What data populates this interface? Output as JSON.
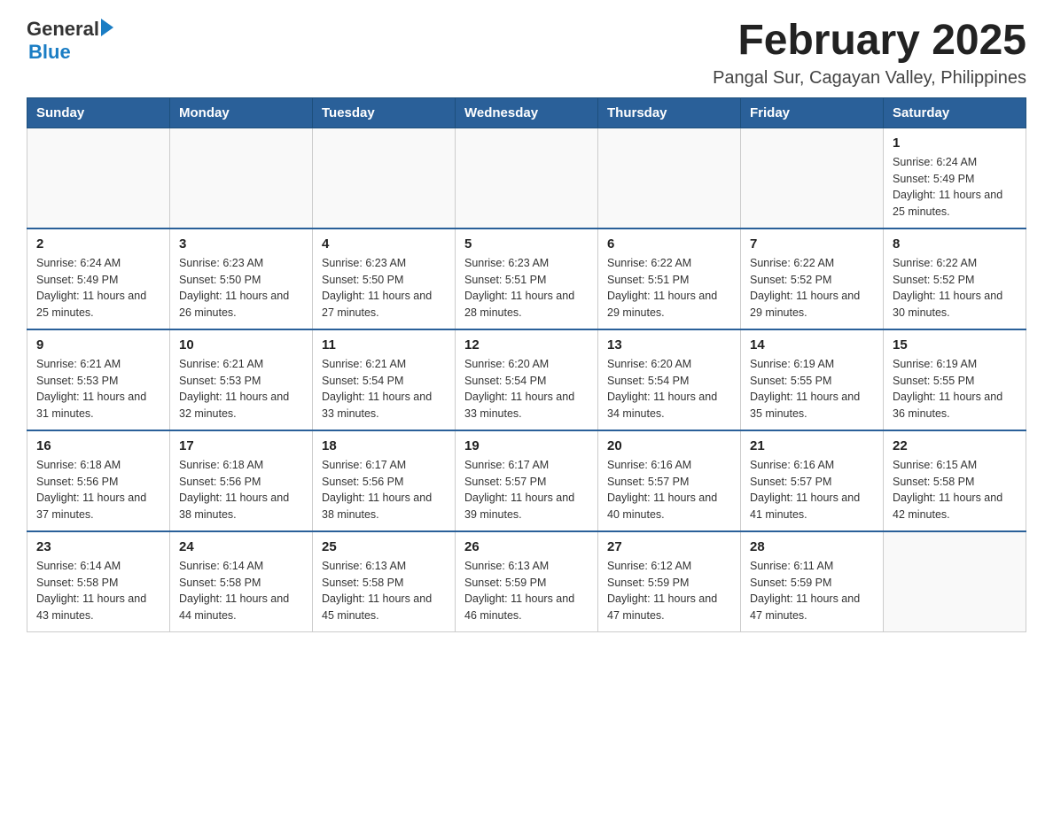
{
  "header": {
    "logo_general": "General",
    "logo_blue": "Blue",
    "month_title": "February 2025",
    "location": "Pangal Sur, Cagayan Valley, Philippines"
  },
  "weekdays": [
    "Sunday",
    "Monday",
    "Tuesday",
    "Wednesday",
    "Thursday",
    "Friday",
    "Saturday"
  ],
  "weeks": [
    [
      {
        "day": "",
        "sunrise": "",
        "sunset": "",
        "daylight": ""
      },
      {
        "day": "",
        "sunrise": "",
        "sunset": "",
        "daylight": ""
      },
      {
        "day": "",
        "sunrise": "",
        "sunset": "",
        "daylight": ""
      },
      {
        "day": "",
        "sunrise": "",
        "sunset": "",
        "daylight": ""
      },
      {
        "day": "",
        "sunrise": "",
        "sunset": "",
        "daylight": ""
      },
      {
        "day": "",
        "sunrise": "",
        "sunset": "",
        "daylight": ""
      },
      {
        "day": "1",
        "sunrise": "Sunrise: 6:24 AM",
        "sunset": "Sunset: 5:49 PM",
        "daylight": "Daylight: 11 hours and 25 minutes."
      }
    ],
    [
      {
        "day": "2",
        "sunrise": "Sunrise: 6:24 AM",
        "sunset": "Sunset: 5:49 PM",
        "daylight": "Daylight: 11 hours and 25 minutes."
      },
      {
        "day": "3",
        "sunrise": "Sunrise: 6:23 AM",
        "sunset": "Sunset: 5:50 PM",
        "daylight": "Daylight: 11 hours and 26 minutes."
      },
      {
        "day": "4",
        "sunrise": "Sunrise: 6:23 AM",
        "sunset": "Sunset: 5:50 PM",
        "daylight": "Daylight: 11 hours and 27 minutes."
      },
      {
        "day": "5",
        "sunrise": "Sunrise: 6:23 AM",
        "sunset": "Sunset: 5:51 PM",
        "daylight": "Daylight: 11 hours and 28 minutes."
      },
      {
        "day": "6",
        "sunrise": "Sunrise: 6:22 AM",
        "sunset": "Sunset: 5:51 PM",
        "daylight": "Daylight: 11 hours and 29 minutes."
      },
      {
        "day": "7",
        "sunrise": "Sunrise: 6:22 AM",
        "sunset": "Sunset: 5:52 PM",
        "daylight": "Daylight: 11 hours and 29 minutes."
      },
      {
        "day": "8",
        "sunrise": "Sunrise: 6:22 AM",
        "sunset": "Sunset: 5:52 PM",
        "daylight": "Daylight: 11 hours and 30 minutes."
      }
    ],
    [
      {
        "day": "9",
        "sunrise": "Sunrise: 6:21 AM",
        "sunset": "Sunset: 5:53 PM",
        "daylight": "Daylight: 11 hours and 31 minutes."
      },
      {
        "day": "10",
        "sunrise": "Sunrise: 6:21 AM",
        "sunset": "Sunset: 5:53 PM",
        "daylight": "Daylight: 11 hours and 32 minutes."
      },
      {
        "day": "11",
        "sunrise": "Sunrise: 6:21 AM",
        "sunset": "Sunset: 5:54 PM",
        "daylight": "Daylight: 11 hours and 33 minutes."
      },
      {
        "day": "12",
        "sunrise": "Sunrise: 6:20 AM",
        "sunset": "Sunset: 5:54 PM",
        "daylight": "Daylight: 11 hours and 33 minutes."
      },
      {
        "day": "13",
        "sunrise": "Sunrise: 6:20 AM",
        "sunset": "Sunset: 5:54 PM",
        "daylight": "Daylight: 11 hours and 34 minutes."
      },
      {
        "day": "14",
        "sunrise": "Sunrise: 6:19 AM",
        "sunset": "Sunset: 5:55 PM",
        "daylight": "Daylight: 11 hours and 35 minutes."
      },
      {
        "day": "15",
        "sunrise": "Sunrise: 6:19 AM",
        "sunset": "Sunset: 5:55 PM",
        "daylight": "Daylight: 11 hours and 36 minutes."
      }
    ],
    [
      {
        "day": "16",
        "sunrise": "Sunrise: 6:18 AM",
        "sunset": "Sunset: 5:56 PM",
        "daylight": "Daylight: 11 hours and 37 minutes."
      },
      {
        "day": "17",
        "sunrise": "Sunrise: 6:18 AM",
        "sunset": "Sunset: 5:56 PM",
        "daylight": "Daylight: 11 hours and 38 minutes."
      },
      {
        "day": "18",
        "sunrise": "Sunrise: 6:17 AM",
        "sunset": "Sunset: 5:56 PM",
        "daylight": "Daylight: 11 hours and 38 minutes."
      },
      {
        "day": "19",
        "sunrise": "Sunrise: 6:17 AM",
        "sunset": "Sunset: 5:57 PM",
        "daylight": "Daylight: 11 hours and 39 minutes."
      },
      {
        "day": "20",
        "sunrise": "Sunrise: 6:16 AM",
        "sunset": "Sunset: 5:57 PM",
        "daylight": "Daylight: 11 hours and 40 minutes."
      },
      {
        "day": "21",
        "sunrise": "Sunrise: 6:16 AM",
        "sunset": "Sunset: 5:57 PM",
        "daylight": "Daylight: 11 hours and 41 minutes."
      },
      {
        "day": "22",
        "sunrise": "Sunrise: 6:15 AM",
        "sunset": "Sunset: 5:58 PM",
        "daylight": "Daylight: 11 hours and 42 minutes."
      }
    ],
    [
      {
        "day": "23",
        "sunrise": "Sunrise: 6:14 AM",
        "sunset": "Sunset: 5:58 PM",
        "daylight": "Daylight: 11 hours and 43 minutes."
      },
      {
        "day": "24",
        "sunrise": "Sunrise: 6:14 AM",
        "sunset": "Sunset: 5:58 PM",
        "daylight": "Daylight: 11 hours and 44 minutes."
      },
      {
        "day": "25",
        "sunrise": "Sunrise: 6:13 AM",
        "sunset": "Sunset: 5:58 PM",
        "daylight": "Daylight: 11 hours and 45 minutes."
      },
      {
        "day": "26",
        "sunrise": "Sunrise: 6:13 AM",
        "sunset": "Sunset: 5:59 PM",
        "daylight": "Daylight: 11 hours and 46 minutes."
      },
      {
        "day": "27",
        "sunrise": "Sunrise: 6:12 AM",
        "sunset": "Sunset: 5:59 PM",
        "daylight": "Daylight: 11 hours and 47 minutes."
      },
      {
        "day": "28",
        "sunrise": "Sunrise: 6:11 AM",
        "sunset": "Sunset: 5:59 PM",
        "daylight": "Daylight: 11 hours and 47 minutes."
      },
      {
        "day": "",
        "sunrise": "",
        "sunset": "",
        "daylight": ""
      }
    ]
  ]
}
